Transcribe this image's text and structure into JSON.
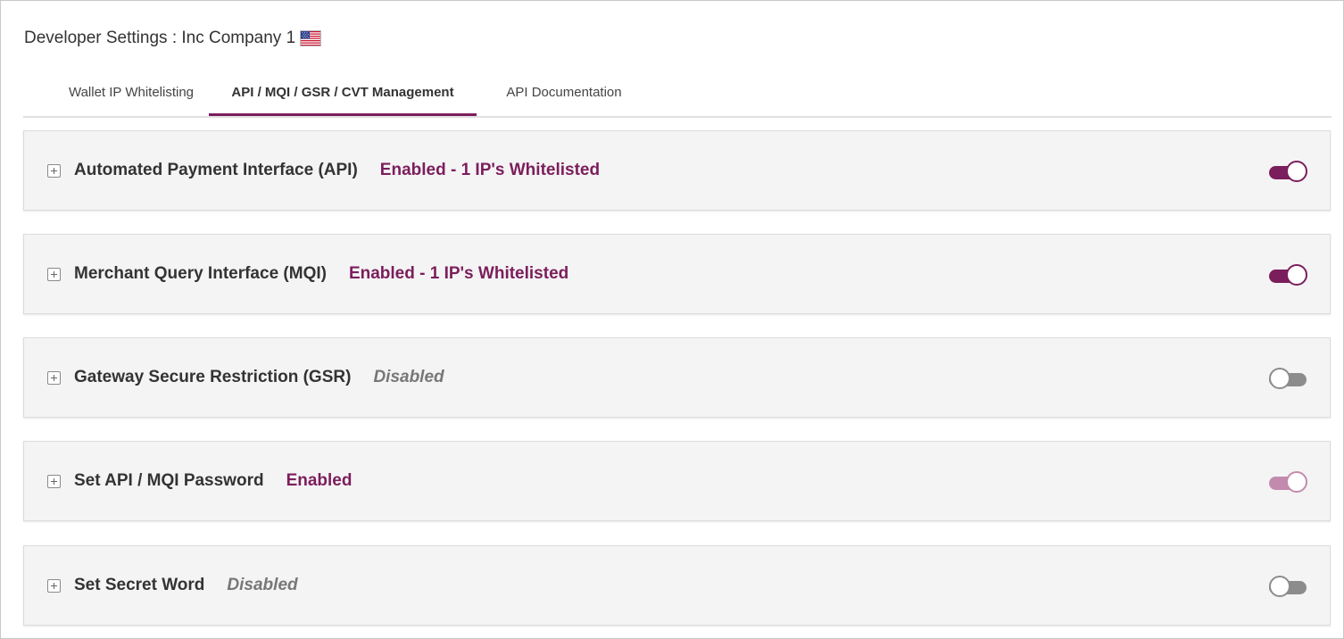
{
  "header": {
    "title": "Developer Settings : Inc Company 1",
    "flag_icon": "us-flag-icon"
  },
  "tabs": [
    {
      "label": "Wallet IP Whitelisting",
      "active": false
    },
    {
      "label": "API / MQI / GSR / CVT Management",
      "active": true
    },
    {
      "label": "API Documentation",
      "active": false
    }
  ],
  "colors": {
    "accent": "#7b1e5c",
    "disabled_text": "#777777",
    "toggle_off": "#8c8c8c",
    "toggle_faded": "#c28bad"
  },
  "settings": [
    {
      "label": "Automated Payment Interface (API)",
      "status": "Enabled - 1 IP's Whitelisted",
      "enabled": true,
      "toggle": "on"
    },
    {
      "label": "Merchant Query Interface (MQI)",
      "status": "Enabled - 1 IP's Whitelisted",
      "enabled": true,
      "toggle": "on"
    },
    {
      "label": "Gateway Secure Restriction (GSR)",
      "status": "Disabled",
      "enabled": false,
      "toggle": "off"
    },
    {
      "label": "Set API / MQI Password",
      "status": "Enabled",
      "enabled": true,
      "toggle": "on-faded"
    },
    {
      "label": "Set Secret Word",
      "status": "Disabled",
      "enabled": false,
      "toggle": "off"
    }
  ]
}
